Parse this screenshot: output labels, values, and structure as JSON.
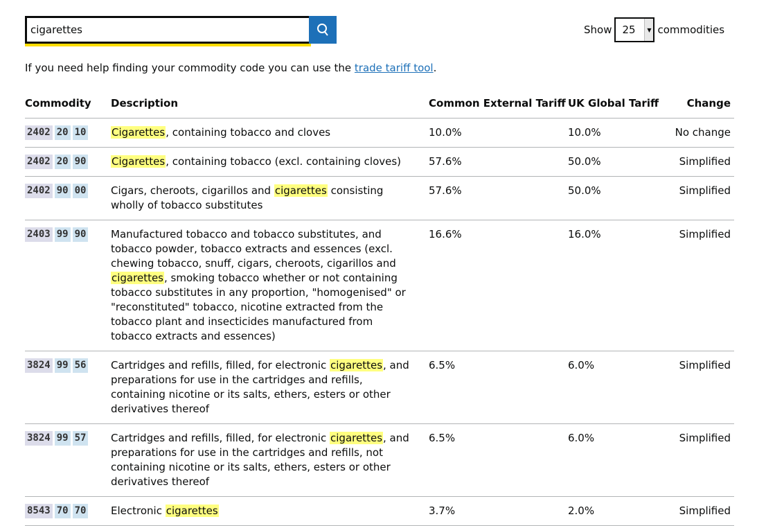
{
  "search": {
    "value": "cigarettes",
    "button_icon": "search-icon"
  },
  "show": {
    "label": "Show",
    "value": "25",
    "suffix": "commodities"
  },
  "help": {
    "text": "If you need help finding your commodity code you can use the ",
    "link": "trade tariff tool",
    "end": "."
  },
  "table": {
    "headers": [
      "Commodity",
      "Description",
      "Common External Tariff",
      "UK Global Tariff",
      "Change"
    ],
    "rows": [
      {
        "code": [
          "2402",
          "20",
          "10"
        ],
        "pre": "",
        "hl": "Cigarettes",
        "post": ", containing tobacco and cloves",
        "cet": "10.0%",
        "ukgt": "10.0%",
        "change": "No change"
      },
      {
        "code": [
          "2402",
          "20",
          "90"
        ],
        "pre": "",
        "hl": "Cigarettes",
        "post": ", containing tobacco (excl. containing cloves)",
        "cet": "57.6%",
        "ukgt": "50.0%",
        "change": "Simplified"
      },
      {
        "code": [
          "2402",
          "90",
          "00"
        ],
        "pre": "Cigars, cheroots, cigarillos and ",
        "hl": "cigarettes",
        "post": " consisting wholly of tobacco substitutes",
        "cet": "57.6%",
        "ukgt": "50.0%",
        "change": "Simplified"
      },
      {
        "code": [
          "2403",
          "99",
          "90"
        ],
        "pre": "Manufactured tobacco and tobacco substitutes, and tobacco powder, tobacco extracts and essences (excl. chewing tobacco, snuff, cigars, cheroots, cigarillos and ",
        "hl": "cigarettes",
        "post": ", smoking tobacco whether or not containing tobacco substitutes in any proportion, \"homogenised\" or \"reconstituted\" tobacco, nicotine extracted from the tobacco plant and insecticides manufactured from tobacco extracts and essences)",
        "cet": "16.6%",
        "ukgt": "16.0%",
        "change": "Simplified"
      },
      {
        "code": [
          "3824",
          "99",
          "56"
        ],
        "pre": "Cartridges and refills, filled, for electronic ",
        "hl": "cigarettes",
        "post": ", and preparations for use in the cartridges and refills, containing nicotine or its salts, ethers, esters or other derivatives thereof",
        "cet": "6.5%",
        "ukgt": "6.0%",
        "change": "Simplified"
      },
      {
        "code": [
          "3824",
          "99",
          "57"
        ],
        "pre": "Cartridges and refills, filled, for electronic ",
        "hl": "cigarettes",
        "post": ", and preparations for use in the cartridges and refills, not containing nicotine or its salts, ethers, esters or other derivatives thereof",
        "cet": "6.5%",
        "ukgt": "6.0%",
        "change": "Simplified"
      },
      {
        "code": [
          "8543",
          "70",
          "70"
        ],
        "pre": "Electronic ",
        "hl": "cigarettes",
        "post": "",
        "cet": "3.7%",
        "ukgt": "2.0%",
        "change": "Simplified"
      }
    ]
  }
}
